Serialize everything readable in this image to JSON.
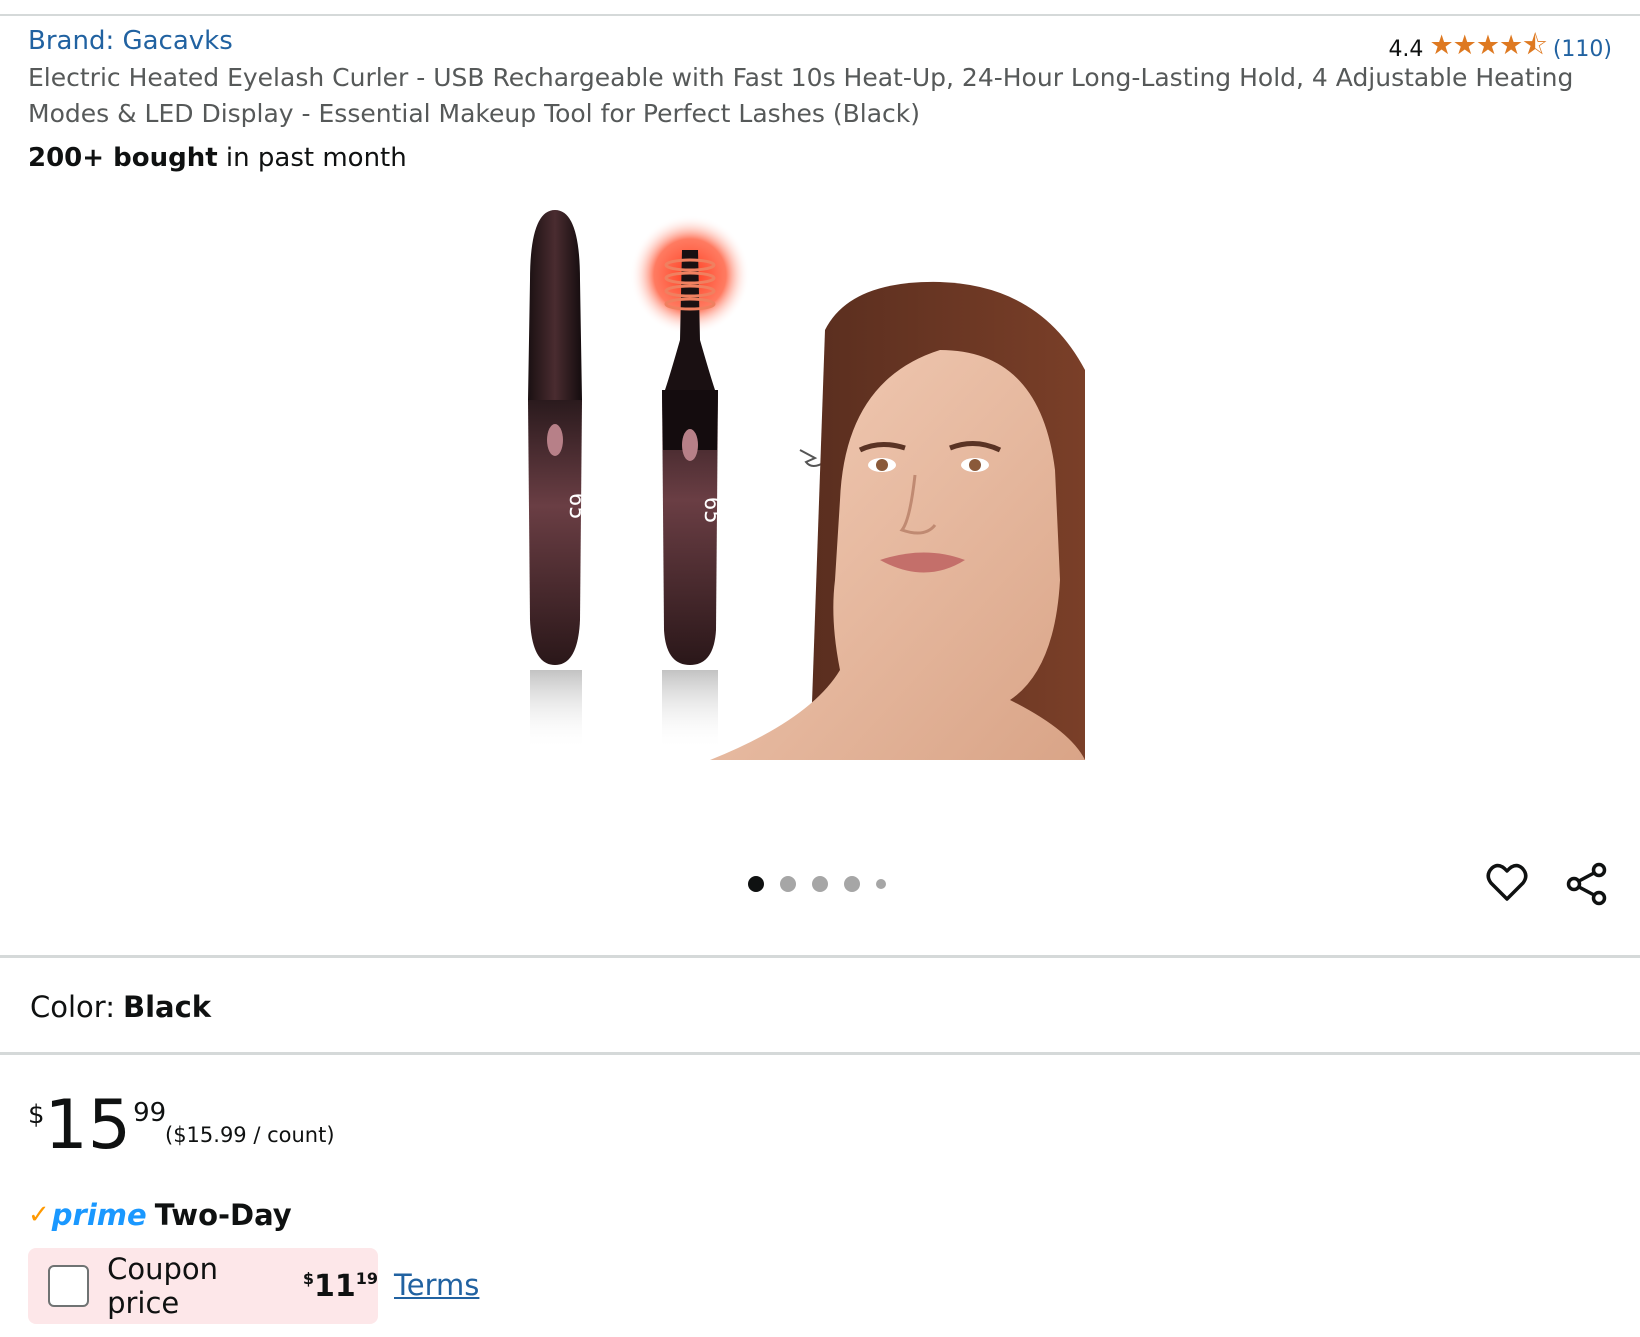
{
  "header": {
    "brand_label": "Brand: Gacavks",
    "title": "Electric Heated Eyelash Curler - USB Rechargeable with Fast 10s Heat-Up, 24-Hour Long-Lasting Hold, 4 Adjustable Heating Modes & LED Display - Essential Makeup Tool for Perfect Lashes (Black)",
    "bought_strong": "200+ bought",
    "bought_rest": " in past month"
  },
  "rating": {
    "value": "4.4",
    "stars": "★★★★⯪",
    "count": "(110)"
  },
  "product_image": {
    "display_text": "65",
    "alt": "eyelash curler product image"
  },
  "gallery": {
    "dot_count": 5,
    "active_index": 0
  },
  "color": {
    "label": "Color:",
    "value": "Black"
  },
  "price": {
    "symbol": "$",
    "whole": "15",
    "fraction": "99",
    "unit": "($15.99 / count)"
  },
  "delivery": {
    "check": "✓",
    "prime_word": "prime",
    "type": "Two-Day"
  },
  "coupon": {
    "label": "Coupon price",
    "symbol": "$",
    "whole": "11",
    "fraction": "19",
    "terms": "Terms"
  },
  "colors": {
    "link": "#2162a1",
    "star": "#de7921",
    "prime_blue": "#1a98ff",
    "coupon_bg": "#fde7e9"
  }
}
